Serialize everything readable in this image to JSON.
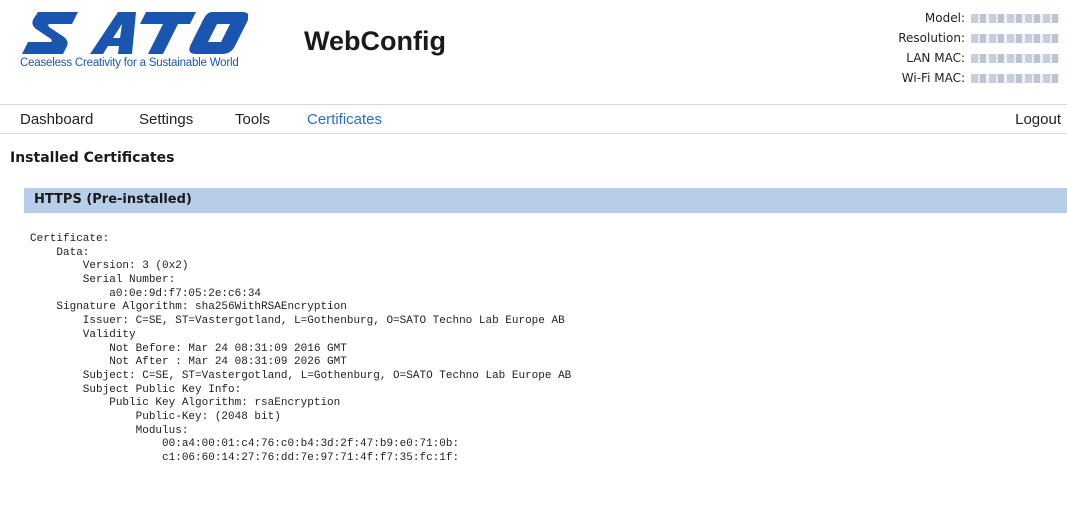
{
  "header": {
    "logo_text": "SATO",
    "tagline": "Ceaseless Creativity for a Sustainable World",
    "app_title": "WebConfig",
    "device_info": [
      {
        "label": "Model:"
      },
      {
        "label": "Resolution:"
      },
      {
        "label": "LAN MAC:"
      },
      {
        "label": "Wi-Fi MAC:"
      }
    ]
  },
  "nav": {
    "items": [
      "Dashboard",
      "Settings",
      "Tools",
      "Certificates"
    ],
    "active": "Certificates",
    "logout": "Logout"
  },
  "main": {
    "section_title": "Installed Certificates",
    "certificate": {
      "title": "HTTPS (Pre-installed)",
      "lines": [
        "Certificate:",
        "    Data:",
        "        Version: 3 (0x2)",
        "        Serial Number:",
        "            a0:0e:9d:f7:05:2e:c6:34",
        "    Signature Algorithm: sha256WithRSAEncryption",
        "        Issuer: C=SE, ST=Vastergotland, L=Gothenburg, O=SATO Techno Lab Europe AB",
        "        Validity",
        "            Not Before: Mar 24 08:31:09 2016 GMT",
        "            Not After : Mar 24 08:31:09 2026 GMT",
        "        Subject: C=SE, ST=Vastergotland, L=Gothenburg, O=SATO Techno Lab Europe AB",
        "        Subject Public Key Info:",
        "            Public Key Algorithm: rsaEncryption",
        "                Public-Key: (2048 bit)",
        "                Modulus:",
        "                    00:a4:00:01:c4:76:c0:b4:3d:2f:47:b9:e0:71:0b:",
        "                    c1:06:60:14:27:76:dd:7e:97:71:4f:f7:35:fc:1f:"
      ]
    }
  },
  "colors": {
    "brand_blue": "#1a56b0",
    "active_nav": "#2d6fc7",
    "cert_header_bg": "#b8cde8"
  }
}
